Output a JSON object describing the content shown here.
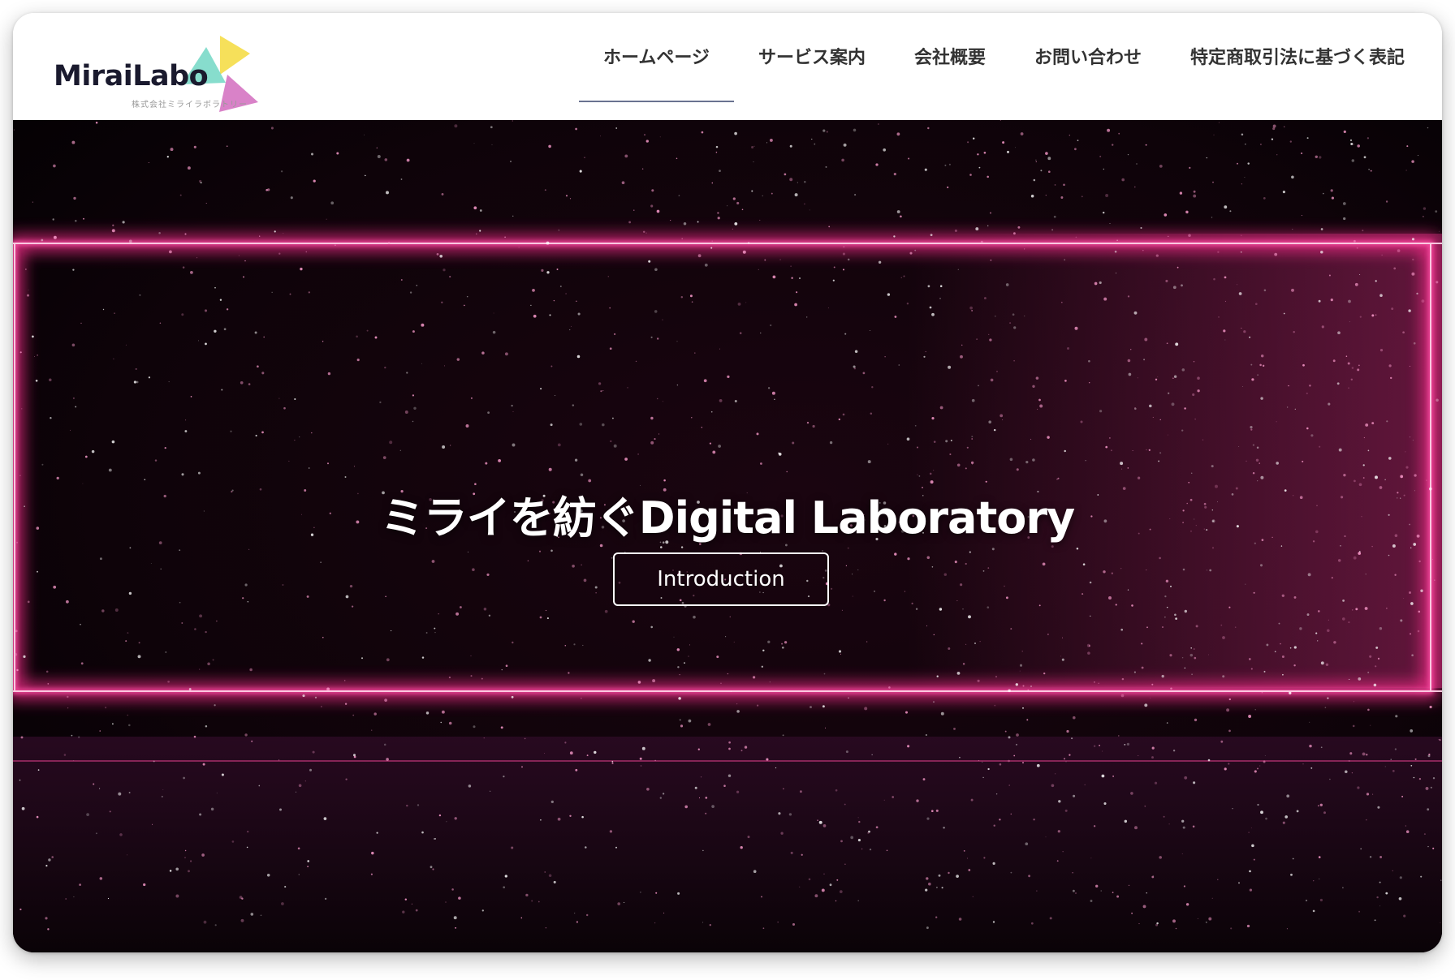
{
  "header": {
    "logo": {
      "wordmark": "MiraiLabo",
      "tagline": "株式会社ミライラボラトリー",
      "colors": {
        "yellow": "#f6e05a",
        "teal": "#7ad9c8",
        "pink": "#d982c8"
      }
    },
    "nav": [
      {
        "label": "ホームページ",
        "active": true
      },
      {
        "label": "サービス案内",
        "active": false
      },
      {
        "label": "会社概要",
        "active": false
      },
      {
        "label": "お問い合わせ",
        "active": false
      },
      {
        "label": "特定商取引法に基づく表記",
        "active": false
      }
    ]
  },
  "hero": {
    "title": "ミライを紡ぐDigital Laboratory",
    "button_label": "Introduction",
    "colors": {
      "neon": "#ff3a9a",
      "background": "#0a0307"
    }
  }
}
